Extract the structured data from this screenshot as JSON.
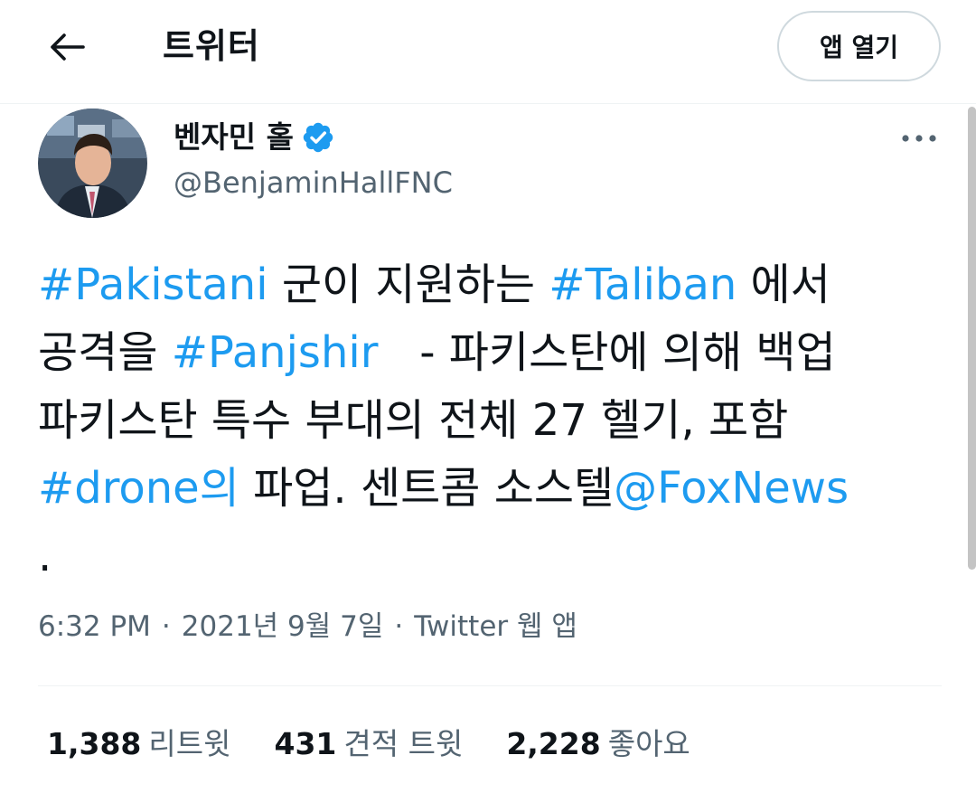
{
  "header": {
    "title": "트위터",
    "open_app_label": "앱 열기"
  },
  "author": {
    "display_name": "벤자민 홀",
    "handle": "@BenjaminHallFNC",
    "verified": true
  },
  "tweet": {
    "lines": [
      [
        {
          "text": "#Pakistani",
          "link": true
        },
        {
          "text": " 군이 지원하는 ",
          "link": false
        },
        {
          "text": "#Taliban",
          "link": true
        },
        {
          "text": " 에서",
          "link": false
        }
      ],
      [
        {
          "text": "공격을 ",
          "link": false
        },
        {
          "text": "#Panjshir",
          "link": true
        },
        {
          "text": "   - 파키스탄에 의해 백업",
          "link": false
        }
      ],
      [
        {
          "text": "파키스탄 특수 부대의 전체 27 헬기, 포함",
          "link": false
        }
      ],
      [
        {
          "text": "#drone의",
          "link": true
        },
        {
          "text": " 파업. 센트콤 소스텔",
          "link": false
        },
        {
          "text": "@FoxNews",
          "link": true
        }
      ],
      [
        {
          "text": ".",
          "link": false
        }
      ]
    ],
    "time": "6:32 PM",
    "date": "2021년 9월 7일",
    "source": "Twitter 웹 앱"
  },
  "stats": {
    "retweets_count": "1,388",
    "retweets_label": "리트윗",
    "quotes_count": "431",
    "quotes_label": "견적 트윗",
    "likes_count": "2,228",
    "likes_label": "좋아요"
  },
  "colors": {
    "accent": "#1d9bf0",
    "text": "#0f1419",
    "secondary_text": "#536471"
  },
  "icons": {
    "back": "arrow-left-icon",
    "verified": "verified-badge-icon",
    "more": "more-horizontal-icon"
  }
}
